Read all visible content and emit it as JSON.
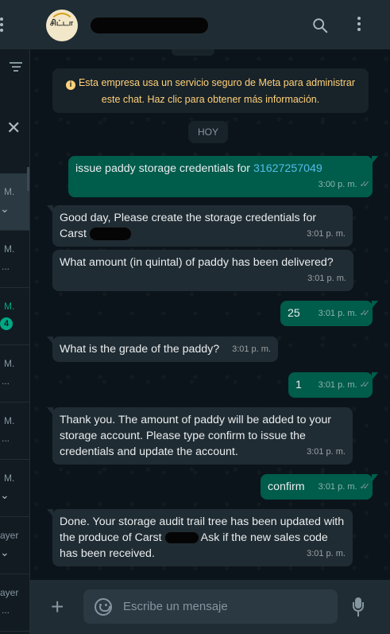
{
  "left_panel": {
    "items": [
      {
        "label": "M.",
        "sub": "⌄",
        "active": true
      },
      {
        "label": "M.",
        "sub": "..."
      },
      {
        "label": "M.",
        "badge": "4",
        "unread": true
      },
      {
        "label": "M.",
        "sub": "..."
      },
      {
        "label": "M.",
        "sub": "..."
      },
      {
        "label": "M.",
        "sub": "⌄"
      },
      {
        "label": "ayer",
        "sub": "⌄"
      },
      {
        "label": "ayer",
        "sub": "..."
      }
    ]
  },
  "header": {
    "avatar_text": "சிட்டா",
    "name_redacted": true
  },
  "notice": {
    "text": "Esta empresa usa un servicio seguro de Meta para administrar este chat. Haz clic para obtener más información."
  },
  "day_label": "HOY",
  "messages": [
    {
      "dir": "out",
      "text": "issue paddy storage credentials for ",
      "link": "31627257049",
      "time": "3:00 p. m."
    },
    {
      "dir": "in",
      "text": "Good day, Please create the storage credentials for Carst",
      "time": "3:01 p. m."
    },
    {
      "dir": "in",
      "text": "What amount (in quintal) of paddy has been delivered?",
      "time": "3:01 p. m."
    },
    {
      "dir": "out",
      "text": "25",
      "time": "3:01 p. m."
    },
    {
      "dir": "in",
      "text": "What is the grade of the paddy?",
      "time": "3:01 p. m."
    },
    {
      "dir": "out",
      "text": "1",
      "time": "3:01 p. m."
    },
    {
      "dir": "in",
      "text": "Thank you. The amount of paddy will be added to your storage account. Please type confirm to issue the credentials and update the account.",
      "time": "3:01 p. m."
    },
    {
      "dir": "out",
      "text": "confirm",
      "time": "3:01 p. m."
    },
    {
      "dir": "in",
      "text_a": "Done. Your storage audit trail tree has been updated with the produce of Carst",
      "text_b": "Ask if the new sales code has been received.",
      "time": "3:01 p. m."
    }
  ],
  "composer": {
    "placeholder": "Escribe un mensaje"
  },
  "colors": {
    "incoming": "#202c33",
    "outgoing": "#005c4b",
    "accent": "#00a884",
    "link": "#53bdeb",
    "notice": "#ffd279"
  }
}
